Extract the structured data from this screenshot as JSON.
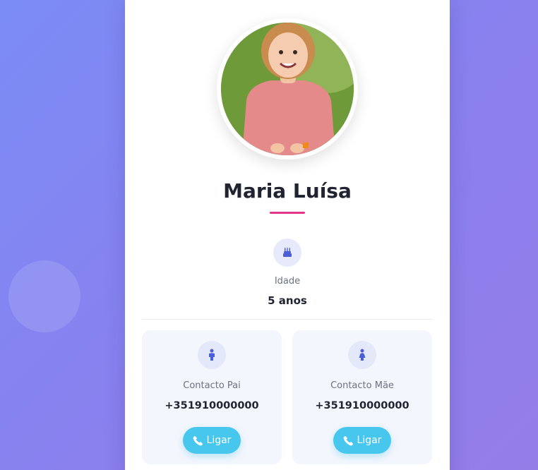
{
  "colors": {
    "accent": "#e0358b",
    "call_button": "#48c7ee",
    "icon": "#4a5ed8",
    "background_start": "#7b8cf6",
    "background_end": "#957de8"
  },
  "profile": {
    "name": "Maria Luísa",
    "photo_icon": "child-photo"
  },
  "age": {
    "icon": "birthday-cake-icon",
    "label": "Idade",
    "value": "5 anos"
  },
  "contacts": [
    {
      "icon": "person-icon",
      "label": "Contacto Pai",
      "phone": "+351910000000",
      "button_label": "Ligar",
      "button_icon": "phone-icon"
    },
    {
      "icon": "person-icon",
      "label": "Contacto Mãe",
      "phone": "+351910000000",
      "button_label": "Ligar",
      "button_icon": "phone-icon"
    }
  ]
}
